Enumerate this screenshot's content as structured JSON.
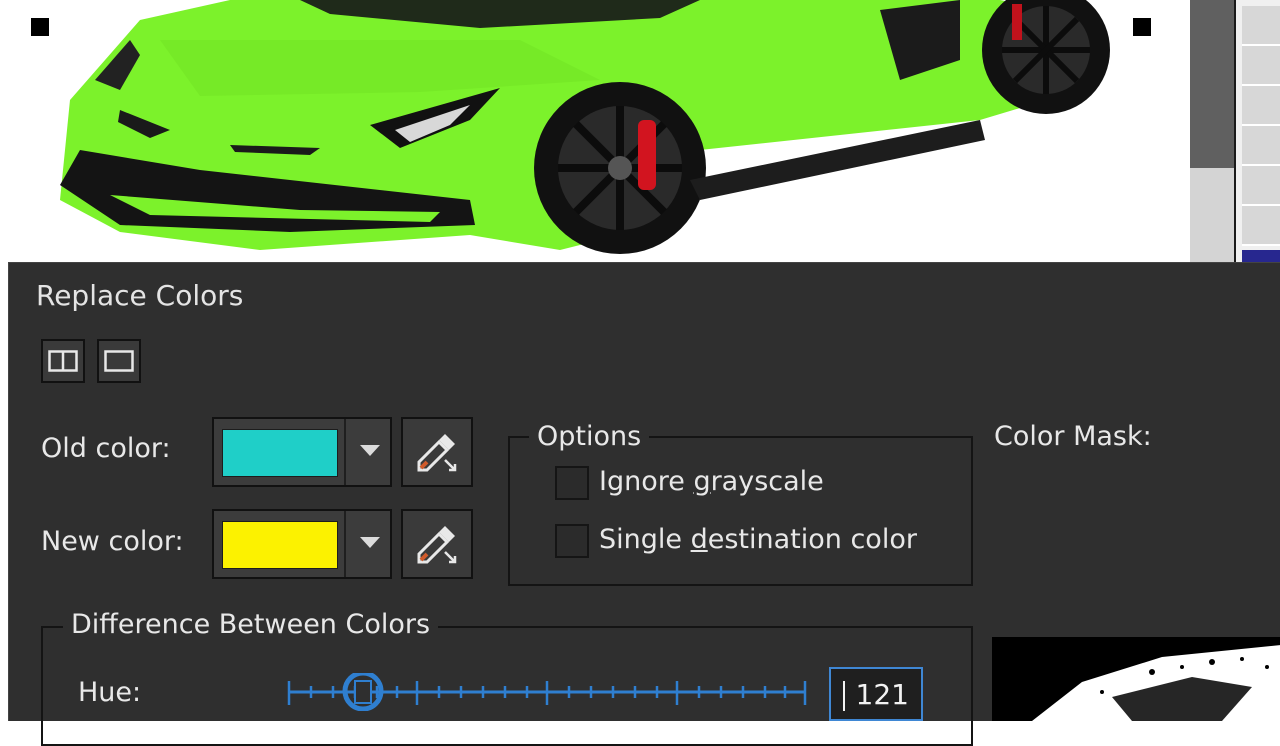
{
  "dialog": {
    "title": "Replace Colors",
    "old_color_label": "Old color:",
    "new_color_label": "New color:",
    "old_color_value": "#1fcfc8",
    "new_color_value": "#fcf200",
    "options": {
      "title": "Options",
      "ignore_grayscale_label_pre": "Ignore ",
      "ignore_grayscale_label_u": "g",
      "ignore_grayscale_label_post": "rayscale",
      "single_dest_label_pre": "Single ",
      "single_dest_label_u": "d",
      "single_dest_label_post": "estination color",
      "ignore_grayscale_checked": false,
      "single_dest_checked": false
    },
    "color_mask_label": "Color Mask:",
    "difference": {
      "title": "Difference Between Colors",
      "hue_label": "Hue:",
      "hue_value": "121"
    }
  },
  "colors": {
    "car_green": "#7cf22b",
    "dialog_bg": "#2f2f2f",
    "focus_blue": "#3f87d4",
    "slider_blue": "#2f7fd0"
  },
  "icons": [
    "split-view-icon",
    "single-view-icon",
    "dropdown-arrow-icon",
    "eyedropper-icon",
    "selection-handle"
  ]
}
